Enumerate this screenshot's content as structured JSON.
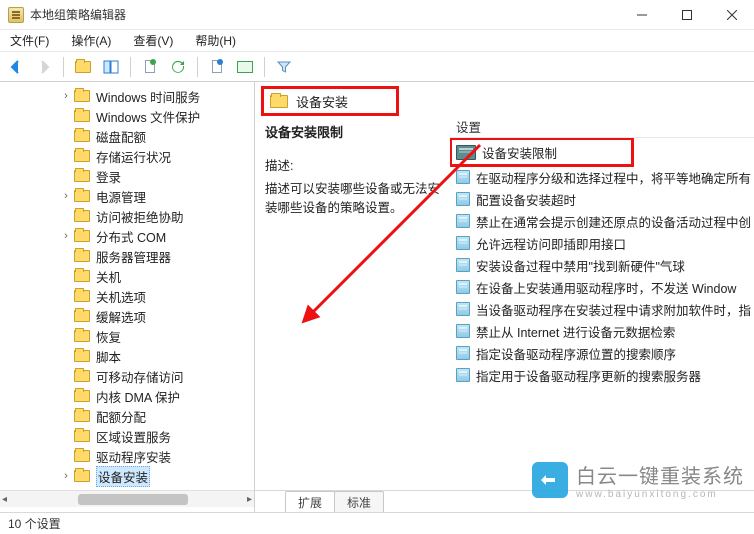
{
  "window": {
    "title": "本地组策略编辑器"
  },
  "menu": {
    "file": "文件(F)",
    "action": "操作(A)",
    "view": "查看(V)",
    "help": "帮助(H)"
  },
  "tree": {
    "items": [
      {
        "label": "Windows 时间服务",
        "expandable": true
      },
      {
        "label": "Windows 文件保护",
        "expandable": false
      },
      {
        "label": "磁盘配额",
        "expandable": false
      },
      {
        "label": "存储运行状况",
        "expandable": false
      },
      {
        "label": "登录",
        "expandable": false
      },
      {
        "label": "电源管理",
        "expandable": true
      },
      {
        "label": "访问被拒绝协助",
        "expandable": false
      },
      {
        "label": "分布式 COM",
        "expandable": true
      },
      {
        "label": "服务器管理器",
        "expandable": false
      },
      {
        "label": "关机",
        "expandable": false
      },
      {
        "label": "关机选项",
        "expandable": false
      },
      {
        "label": "缓解选项",
        "expandable": false
      },
      {
        "label": "恢复",
        "expandable": false
      },
      {
        "label": "脚本",
        "expandable": false
      },
      {
        "label": "可移动存储访问",
        "expandable": false
      },
      {
        "label": "内核 DMA 保护",
        "expandable": false
      },
      {
        "label": "配额分配",
        "expandable": false
      },
      {
        "label": "区域设置服务",
        "expandable": false
      },
      {
        "label": "驱动程序安装",
        "expandable": false
      },
      {
        "label": "设备安装",
        "expandable": true,
        "selected": true
      }
    ]
  },
  "header": {
    "label": "设备安装"
  },
  "desc": {
    "title": "设备安装限制",
    "sub": "描述:",
    "body": "描述可以安装哪些设备或无法安装哪些设备的策略设置。"
  },
  "listHeader": "设置",
  "list": {
    "items": [
      {
        "label": "设备安装限制",
        "type": "folder",
        "highlight": true
      },
      {
        "label": "在驱动程序分级和选择过程中，将平等地确定所有",
        "type": "policy"
      },
      {
        "label": "配置设备安装超时",
        "type": "policy"
      },
      {
        "label": "禁止在通常会提示创建还原点的设备活动过程中创",
        "type": "policy"
      },
      {
        "label": "允许远程访问即插即用接口",
        "type": "policy"
      },
      {
        "label": "安装设备过程中禁用\"找到新硬件\"气球",
        "type": "policy"
      },
      {
        "label": "在设备上安装通用驱动程序时，不发送 Window",
        "type": "policy"
      },
      {
        "label": "当设备驱动程序在安装过程中请求附加软件时，指",
        "type": "policy"
      },
      {
        "label": "禁止从 Internet 进行设备元数据检索",
        "type": "policy"
      },
      {
        "label": "指定设备驱动程序源位置的搜索顺序",
        "type": "policy"
      },
      {
        "label": "指定用于设备驱动程序更新的搜索服务器",
        "type": "policy"
      }
    ]
  },
  "tabs": {
    "extended": "扩展",
    "standard": "标准"
  },
  "status": "10 个设置",
  "watermark": {
    "text": "白云一键重装系统",
    "sub": "www.baiyunxitong.com"
  }
}
